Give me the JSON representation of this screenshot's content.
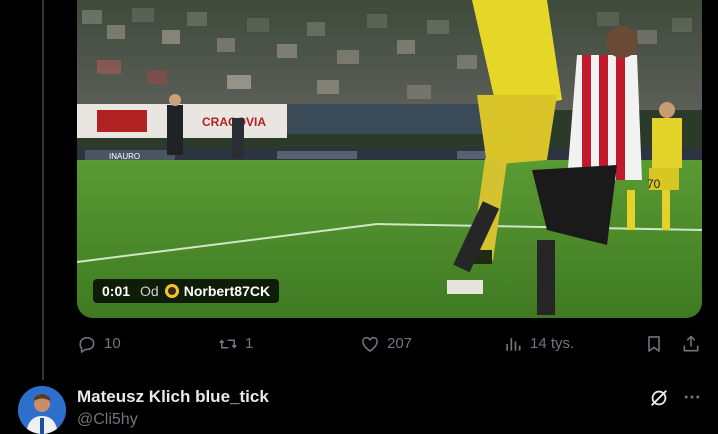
{
  "video": {
    "time": "0:01",
    "from_label": "Od",
    "uploader": "Norbert87CK",
    "emoji_icon": "soccer-face-emoji"
  },
  "stadium_boards": {
    "board_left": "CRACOVIA",
    "board_small": "INAURO"
  },
  "players": {
    "yellow_number": "70"
  },
  "actions": {
    "reply_count": "10",
    "retweet_count": "1",
    "like_count": "207",
    "views_count": "14 tys."
  },
  "next_tweet": {
    "display_name": "Mateusz Klich blue_tick",
    "handle": "@Cli5hy"
  },
  "colors": {
    "background": "#000000",
    "muted": "#71767b",
    "text": "#e7e9ea",
    "pitch": "#4f8a2c"
  }
}
